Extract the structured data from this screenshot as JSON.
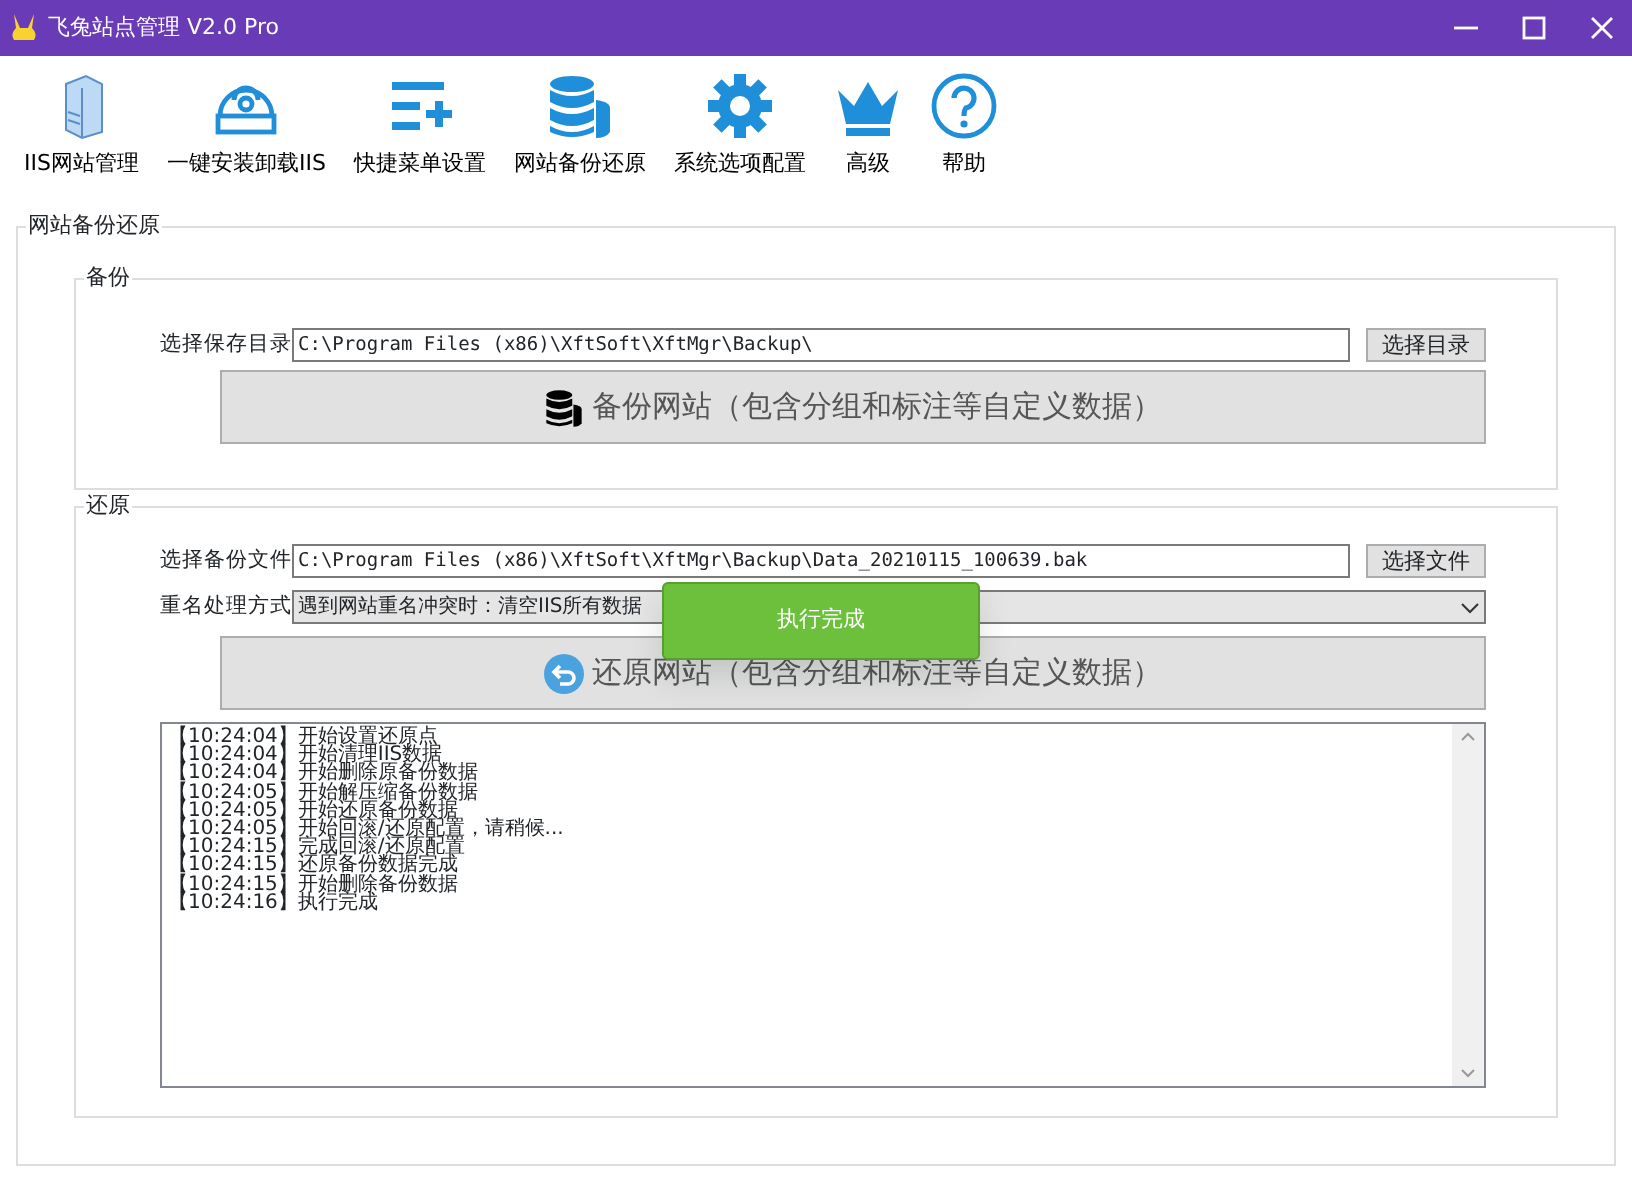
{
  "window": {
    "title": "飞兔站点管理 V2.0 Pro"
  },
  "toolbar": [
    {
      "kind": "server",
      "label": "IIS网站管理"
    },
    {
      "kind": "disk",
      "label": "一键安装卸载IIS"
    },
    {
      "kind": "menu",
      "label": "快捷菜单设置"
    },
    {
      "kind": "database",
      "label": "网站备份还原"
    },
    {
      "kind": "gear",
      "label": "系统选项配置"
    },
    {
      "kind": "crown",
      "label": "高级"
    },
    {
      "kind": "help",
      "label": "帮助"
    }
  ],
  "panel": {
    "title": "网站备份还原",
    "backup": {
      "title": "备份",
      "dir_label": "选择保存目录",
      "dir_value": "C:\\Program Files (x86)\\XftSoft\\XftMgr\\Backup\\",
      "dir_button": "选择目录",
      "action": "备份网站（包含分组和标注等自定义数据）"
    },
    "restore": {
      "title": "还原",
      "file_label": "选择备份文件",
      "file_value": "C:\\Program Files (x86)\\XftSoft\\XftMgr\\Backup\\Data_20210115_100639.bak",
      "file_button": "选择文件",
      "mode_label": "重名处理方式",
      "mode_value": "遇到网站重名冲突时：清空IIS所有数据",
      "action": "还原网站（包含分组和标注等自定义数据）",
      "log": [
        "【10:24:04】开始设置还原点",
        "【10:24:04】开始清理IIS数据",
        "【10:24:04】开始删除原备份数据",
        "【10:24:05】开始解压缩备份数据",
        "【10:24:05】开始还原备份数据",
        "【10:24:05】开始回滚/还原配置，请稍候...",
        "【10:24:15】完成回滚/还原配置",
        "【10:24:15】还原备份数据完成",
        "【10:24:15】开始删除备份数据",
        "【10:24:16】执行完成"
      ]
    }
  },
  "toast": {
    "text": "执行完成"
  }
}
